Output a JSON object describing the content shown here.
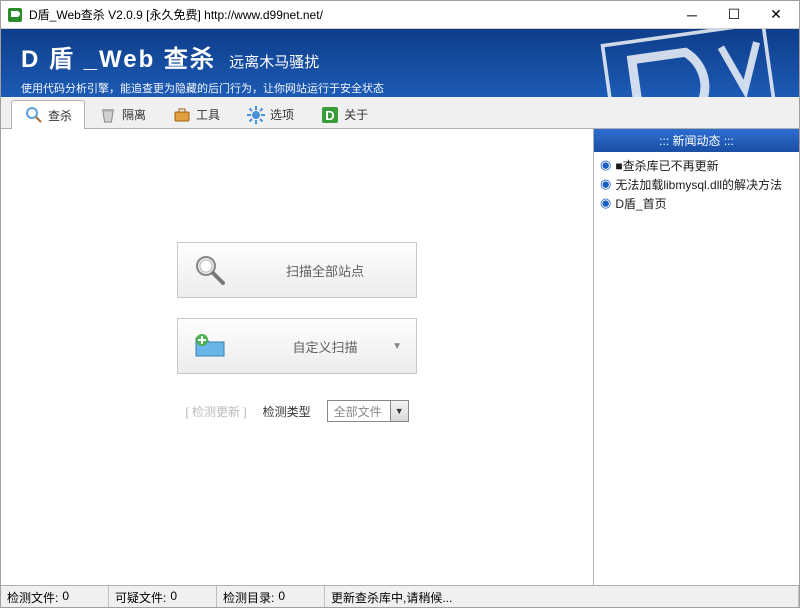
{
  "window": {
    "title": "D盾_Web查杀 V2.0.9 [永久免费] http://www.d99net.net/"
  },
  "banner": {
    "title": "D 盾 _Web 查杀",
    "subtitle_inline": "远离木马骚扰",
    "desc": "使用代码分析引擎，能追查更为隐藏的后门行为，让你网站运行于安全状态"
  },
  "tabs": [
    {
      "label": "查杀",
      "icon": "search-icon"
    },
    {
      "label": "隔离",
      "icon": "trash-icon"
    },
    {
      "label": "工具",
      "icon": "briefcase-icon"
    },
    {
      "label": "选项",
      "icon": "gear-icon"
    },
    {
      "label": "关于",
      "icon": "about-icon"
    }
  ],
  "main": {
    "scan_all_btn": "扫描全部站点",
    "custom_scan_btn": "自定义扫描",
    "check_update": "[ 检测更新 ]",
    "detect_type_label": "检测类型",
    "detect_type_value": "全部文件"
  },
  "news": {
    "header": "::: 新闻动态 :::",
    "items": [
      "■查杀库已不再更新",
      "无法加载libmysql.dll的解决方法",
      "D盾_首页"
    ]
  },
  "status": {
    "files_label": "检测文件:",
    "files_value": "0",
    "suspicious_label": "可疑文件:",
    "suspicious_value": "0",
    "dirs_label": "检测目录:",
    "dirs_value": "0",
    "db_update": "更新查杀库中,请稍候..."
  }
}
